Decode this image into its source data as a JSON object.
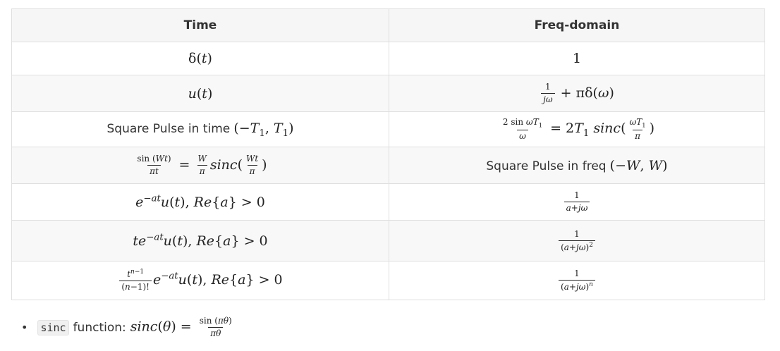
{
  "table": {
    "headers": [
      "Time",
      "Freq-domain"
    ],
    "rows": [
      {
        "time": "δ(t)",
        "freq": "1"
      },
      {
        "time": "u(t)",
        "freq": "1/(jω) + πδ(ω)"
      },
      {
        "time": "Square Pulse in time (−T₁, T₁)",
        "freq": "2 sin ωT₁ / ω = 2T₁ sinc(ωT₁/π)"
      },
      {
        "time": "sin (Wt)/(πt) = (W/π) sinc(Wt/π)",
        "freq": "Square Pulse in freq (−W, W)"
      },
      {
        "time": "e^(−at) u(t), Re{a} > 0",
        "freq": "1/(a+jω)"
      },
      {
        "time": "t e^(−at) u(t), Re{a} > 0",
        "freq": "1/(a+jω)²"
      },
      {
        "time": "t^(n−1)/(n−1)! e^(−at) u(t), Re{a} > 0",
        "freq": "1/(a+jω)^n"
      }
    ],
    "text_labels": {
      "square_pulse_time": "Square Pulse in time",
      "square_pulse_freq": "Square Pulse in freq"
    }
  },
  "note": {
    "bullet": "•",
    "code": "sinc",
    "text": "function:",
    "formula": "sinc(θ) = sin (πθ)/(πθ)"
  }
}
